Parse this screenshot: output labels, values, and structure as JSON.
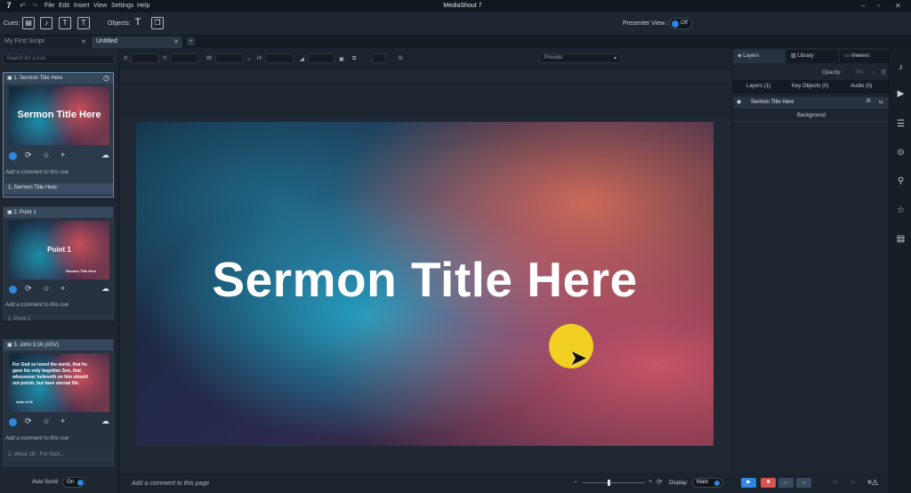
{
  "app": {
    "title": "MediaShout 7",
    "logo": "7"
  },
  "menu": [
    "File",
    "Edit",
    "Insert",
    "View",
    "Settings",
    "Help"
  ],
  "toolbar": {
    "cues_label": "Cues:",
    "objects_label": "Objects:",
    "presenter_view_label": "Presenter View :",
    "presenter_view_state": "Off"
  },
  "tabs": [
    {
      "label": "My First Script"
    },
    {
      "label": "Untitled"
    }
  ],
  "search": {
    "placeholder": "Search for a cue"
  },
  "cues": [
    {
      "header": "1.  Sermon Title Here",
      "thumb_text": "Sermon Title Here",
      "comment": "Add a comment to this cue",
      "subtitle": "1. Sermon Title Here"
    },
    {
      "header": "2.  Point 1",
      "thumb_text": "Point 1",
      "thumb_small": "Sermon Title Here",
      "comment": "Add a comment to this cue",
      "subtitle": "1. Point 1"
    },
    {
      "header": "3.  John 3:16 (ASV)",
      "thumb_text": "For God so loved the world, that he gave his only begotten Son, that whosoever believeth on him should not perish, but have eternal life.",
      "thumb_small": "John 3:16",
      "comment": "Add a comment to this cue",
      "subtitle": "1. Verse 16 - For God..."
    }
  ],
  "autoscroll": {
    "label": "Auto Scroll",
    "state": "On"
  },
  "props": {
    "x": "X:",
    "y": "Y:",
    "w": "W:",
    "h": "H:",
    "fx": "fx",
    "presets": "Presets"
  },
  "slide": {
    "title": "Sermon Title Here"
  },
  "bottom": {
    "comment": "Add a comment to this page",
    "display_label": "Display:",
    "display_value": "Main"
  },
  "right": {
    "tabs": [
      "Layers",
      "Library",
      "Viewers"
    ],
    "opacity_label": "Opacity:",
    "opacity_value": "0%",
    "subtabs": [
      "Layers (1)",
      "Key Objects (0)",
      "Audio (0)"
    ],
    "layer_name": "Sermon Title Here",
    "layer_fx": "fx",
    "background": "Background"
  },
  "colors": {
    "accent": "#2e86de",
    "stop": "#d9534f",
    "highlight": "#f2d022"
  }
}
